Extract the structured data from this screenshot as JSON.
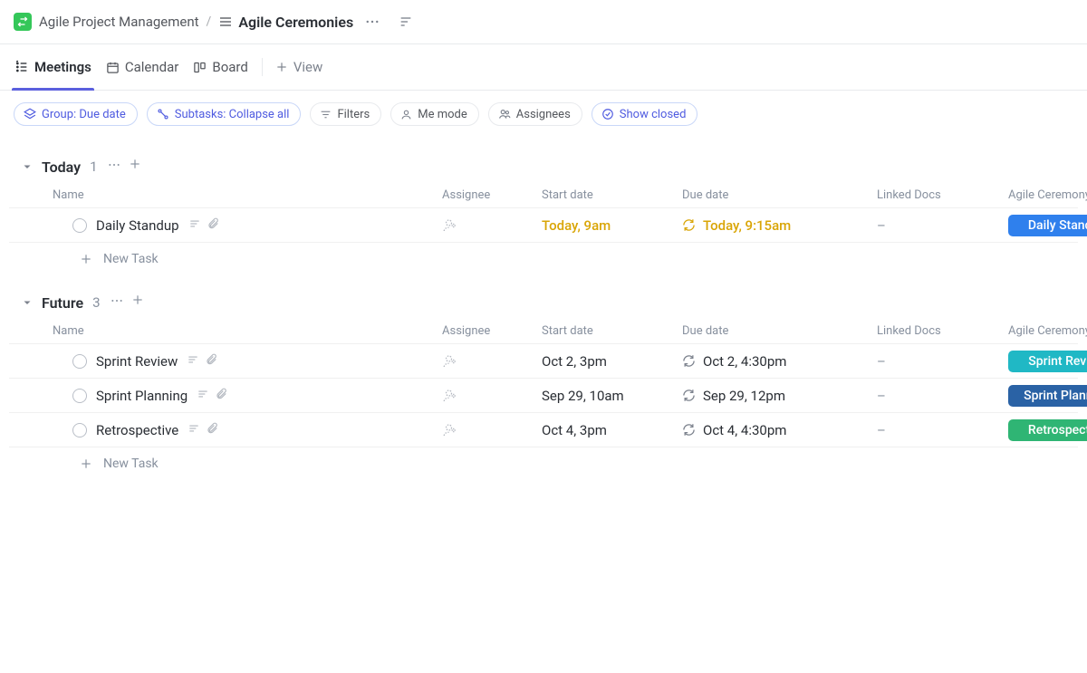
{
  "breadcrumb": {
    "workspace": "Agile Project Management",
    "page": "Agile Ceremonies"
  },
  "tabs": {
    "meetings": "Meetings",
    "calendar": "Calendar",
    "board": "Board",
    "add_view": "View"
  },
  "filters": {
    "group": "Group: Due date",
    "subtasks": "Subtasks: Collapse all",
    "filters": "Filters",
    "me_mode": "Me mode",
    "assignees": "Assignees",
    "show_closed": "Show closed"
  },
  "columns": {
    "name": "Name",
    "assignee": "Assignee",
    "start_date": "Start date",
    "due_date": "Due date",
    "linked_docs": "Linked Docs",
    "ceremony": "Agile Ceremony"
  },
  "new_task": "New Task",
  "groups": [
    {
      "title": "Today",
      "count": "1",
      "rows": [
        {
          "name": "Daily Standup",
          "start": "Today, 9am",
          "due": "Today, 9:15am",
          "docs": "–",
          "is_today": true,
          "badge": {
            "label": "Daily Standup",
            "color": "#2f80ed"
          }
        }
      ]
    },
    {
      "title": "Future",
      "count": "3",
      "rows": [
        {
          "name": "Sprint Review",
          "start": "Oct 2, 3pm",
          "due": "Oct 2, 4:30pm",
          "docs": "–",
          "is_today": false,
          "badge": {
            "label": "Sprint Review",
            "color": "#20b8c5"
          }
        },
        {
          "name": "Sprint Planning",
          "start": "Sep 29, 10am",
          "due": "Sep 29, 12pm",
          "docs": "–",
          "is_today": false,
          "badge": {
            "label": "Sprint Planning",
            "color": "#2a62a5"
          }
        },
        {
          "name": "Retrospective",
          "start": "Oct 4, 3pm",
          "due": "Oct 4, 4:30pm",
          "docs": "–",
          "is_today": false,
          "badge": {
            "label": "Retrospective",
            "color": "#2fb574"
          }
        }
      ]
    }
  ]
}
